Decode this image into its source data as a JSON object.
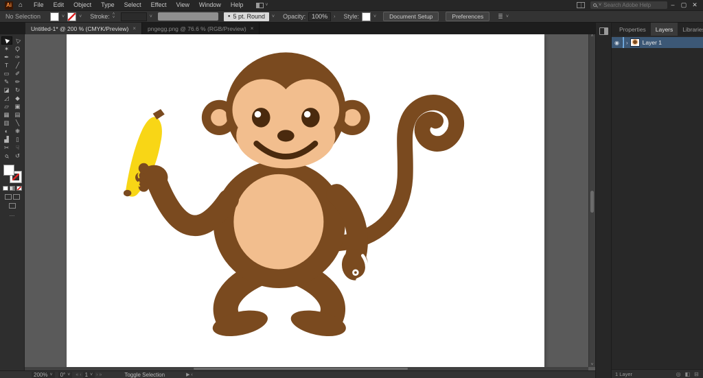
{
  "icons": {
    "chevron_down": "˅",
    "chevron_up": "˄",
    "chevron_right": "›",
    "bullet": "●",
    "menu_hamburger": "≡",
    "ellipsis": "⋯",
    "eye": "◉",
    "target": "○",
    "close_x": "✕",
    "minimize": "–",
    "restore": "▢",
    "tab_close": "×",
    "home": "⌂",
    "options": "≣"
  },
  "menu_bar": {
    "logo": "Ai",
    "menus": [
      {
        "name": "menu-file",
        "label": "File"
      },
      {
        "name": "menu-edit",
        "label": "Edit"
      },
      {
        "name": "menu-object",
        "label": "Object"
      },
      {
        "name": "menu-type",
        "label": "Type"
      },
      {
        "name": "menu-select",
        "label": "Select"
      },
      {
        "name": "menu-effect",
        "label": "Effect"
      },
      {
        "name": "menu-view",
        "label": "View"
      },
      {
        "name": "menu-window",
        "label": "Window"
      },
      {
        "name": "menu-help",
        "label": "Help"
      }
    ],
    "search_placeholder": "Search Adobe Help"
  },
  "control_bar": {
    "selection_status": "No Selection",
    "stroke_label": "Stroke:",
    "brush_name": "5 pt. Round",
    "opacity_label": "Opacity:",
    "opacity_value": "100%",
    "style_label": "Style:",
    "document_setup": "Document Setup",
    "preferences": "Preferences"
  },
  "document_tabs": [
    {
      "label": "Untitled-1* @ 200 % (CMYK/Preview)",
      "active": true
    },
    {
      "label": "pngegg.png @ 76.6 % (RGB/Preview)",
      "active": false
    }
  ],
  "toolbar": {
    "tools": [
      {
        "name": "selection-tool",
        "glyph": "▶",
        "rot": -135,
        "active": true
      },
      {
        "name": "direct-selection-tool",
        "glyph": "▷",
        "rot": -135
      },
      {
        "name": "magic-wand-tool",
        "glyph": "✶"
      },
      {
        "name": "lasso-tool",
        "glyph": "Ϙ"
      },
      {
        "name": "pen-tool",
        "glyph": "✒"
      },
      {
        "name": "curvature-tool",
        "glyph": "✑"
      },
      {
        "name": "type-tool",
        "glyph": "T"
      },
      {
        "name": "line-segment-tool",
        "glyph": "╱"
      },
      {
        "name": "rectangle-tool",
        "glyph": "▭"
      },
      {
        "name": "paintbrush-tool",
        "glyph": "✐"
      },
      {
        "name": "pencil-tool",
        "glyph": "✎"
      },
      {
        "name": "shaper-tool",
        "glyph": "✏"
      },
      {
        "name": "eraser-tool",
        "glyph": "◪"
      },
      {
        "name": "rotate-tool",
        "glyph": "↻"
      },
      {
        "name": "scale-tool",
        "glyph": "◿"
      },
      {
        "name": "width-tool",
        "glyph": "◆"
      },
      {
        "name": "free-transform-tool",
        "glyph": "▱"
      },
      {
        "name": "shape-builder-tool",
        "glyph": "▣"
      },
      {
        "name": "perspective-grid-tool",
        "glyph": "▦"
      },
      {
        "name": "mesh-tool",
        "glyph": "▤"
      },
      {
        "name": "gradient-tool",
        "glyph": "▥"
      },
      {
        "name": "eyedropper-tool",
        "glyph": "╲"
      },
      {
        "name": "blend-tool",
        "glyph": "◐"
      },
      {
        "name": "symbol-sprayer-tool",
        "glyph": "❋"
      },
      {
        "name": "column-graph-tool",
        "glyph": "▟"
      },
      {
        "name": "artboard-tool",
        "glyph": "▯"
      },
      {
        "name": "slice-tool",
        "glyph": "✂"
      },
      {
        "name": "hand-tool",
        "glyph": "☟"
      },
      {
        "name": "zoom-tool",
        "glyph": "ϙ",
        "rot": -45
      },
      {
        "name": "rotate-view-tool",
        "glyph": "↺"
      }
    ]
  },
  "right_panel": {
    "tabs": {
      "properties": "Properties",
      "layers": "Layers",
      "libraries": "Libraries"
    },
    "layer": {
      "name": "Layer 1",
      "expand": "›"
    },
    "footer": {
      "count": "1 Layer"
    },
    "footer_icons": [
      {
        "name": "locate-object-icon",
        "glyph": "◎"
      },
      {
        "name": "make-mask-icon",
        "glyph": "◧"
      },
      {
        "name": "new-sublayer-icon",
        "glyph": "⊟"
      },
      {
        "name": "new-layer-icon",
        "glyph": "⊞"
      },
      {
        "name": "delete-layer-icon",
        "glyph": "▭"
      }
    ]
  },
  "status_bar": {
    "zoom": "200%",
    "rotation": "0°",
    "artboard_number": "1",
    "nav": {
      "first": "«",
      "prev": "‹",
      "next": "›",
      "last": "»"
    },
    "message": "Toggle Selection",
    "side_icons": "▶ ‹"
  },
  "artwork": {
    "description": "Cartoon monkey holding a banana",
    "colors": {
      "body": "#7A4A1F",
      "face": "#F2BE8E",
      "features": "#4A2A0E",
      "banana": "#F8D616",
      "canvas": "#FFFFFF"
    }
  }
}
